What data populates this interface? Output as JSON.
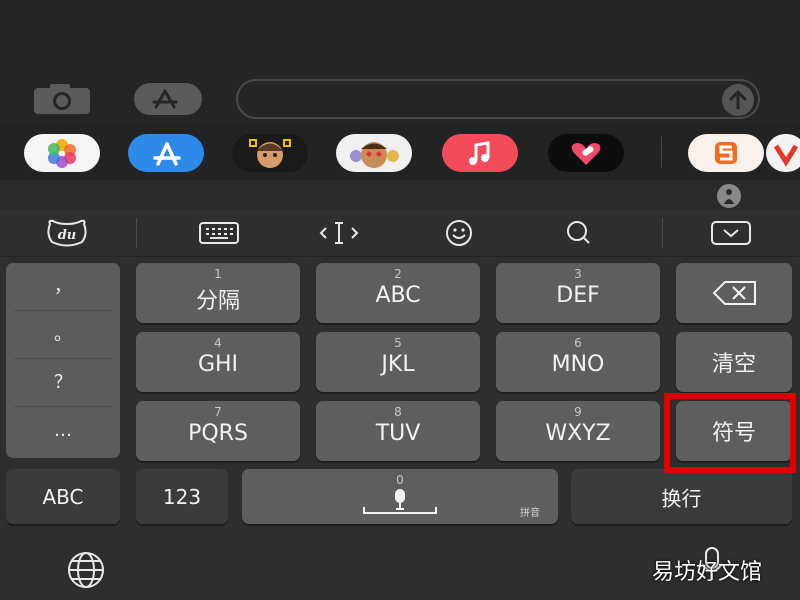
{
  "app_strip": {
    "apps": [
      "photos-app",
      "app-store-app",
      "memoji-app",
      "animoji-app",
      "music-app",
      "fitness-app",
      "sogou-app",
      "partial-app"
    ],
    "colors": {
      "music": "#f24b5a",
      "appstore": "#2e8ae8",
      "sogou": "#f9f2ec"
    }
  },
  "toolbar": {
    "icons": [
      "du-logo-icon",
      "keyboard-icon",
      "cursor-icon",
      "emoji-icon",
      "search-icon",
      "collapse-keyboard-icon"
    ]
  },
  "punctuation": {
    "items": [
      "，",
      "。",
      "？",
      "…"
    ]
  },
  "keys": {
    "k1": {
      "num": "1",
      "label": "分隔"
    },
    "k2": {
      "num": "2",
      "label": "ABC"
    },
    "k3": {
      "num": "3",
      "label": "DEF"
    },
    "k4": {
      "num": "4",
      "label": "GHI"
    },
    "k5": {
      "num": "5",
      "label": "JKL"
    },
    "k6": {
      "num": "6",
      "label": "MNO"
    },
    "k7": {
      "num": "7",
      "label": "PQRS"
    },
    "k8": {
      "num": "8",
      "label": "TUV"
    },
    "k9": {
      "num": "9",
      "label": "WXYZ"
    },
    "k0": {
      "num": "0",
      "sub": "拼音"
    }
  },
  "side": {
    "clear": "清空",
    "symbols": "符号"
  },
  "bottom": {
    "abc": "ABC",
    "num": "123",
    "enter": "换行"
  },
  "watermark": "易坊好文馆",
  "highlight_color": "#e00000"
}
